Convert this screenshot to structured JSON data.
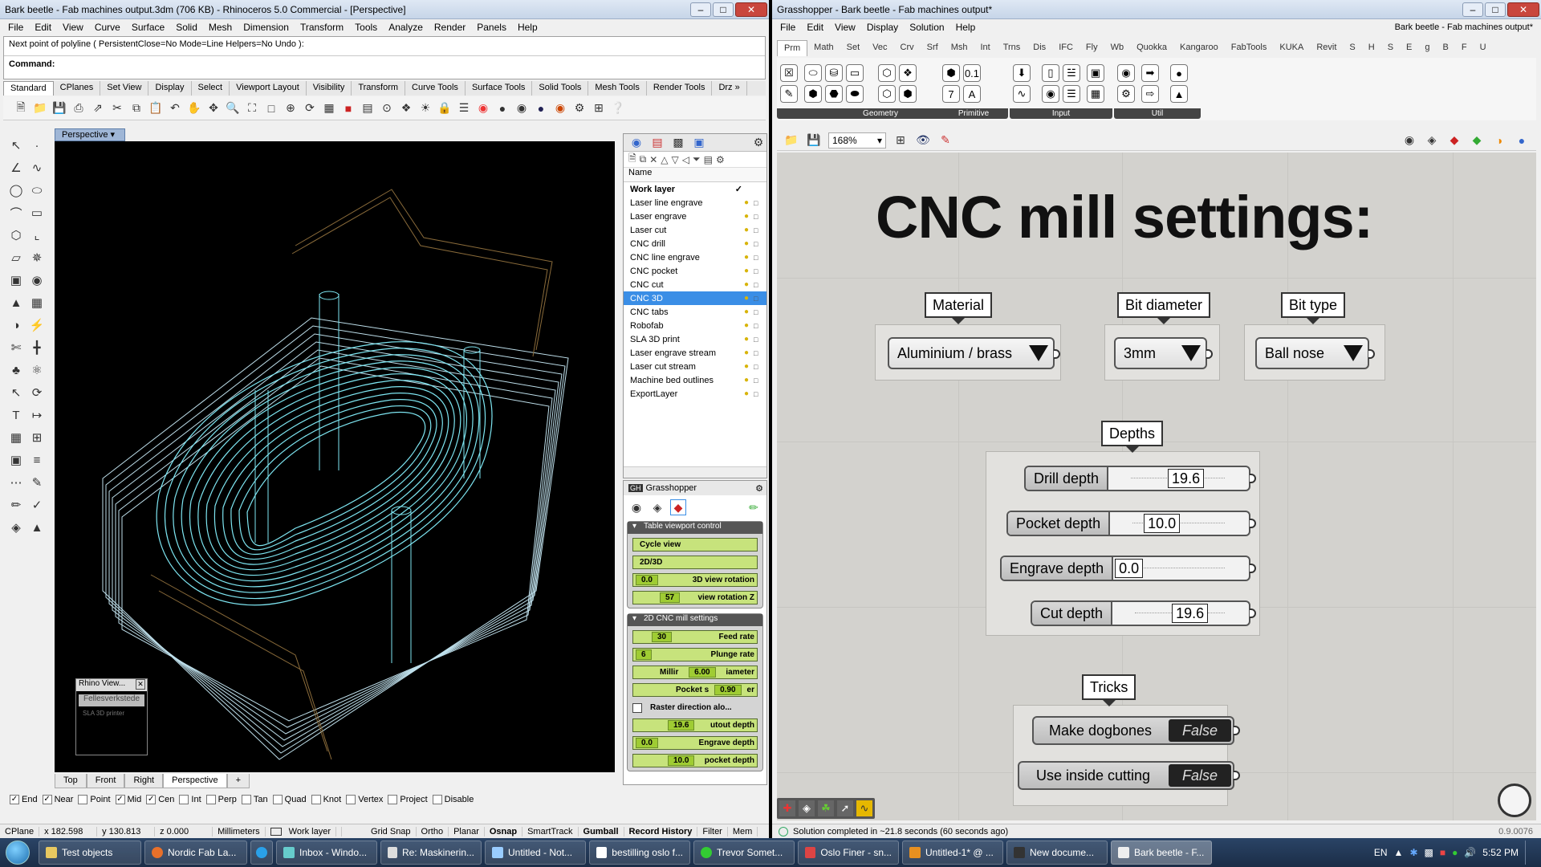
{
  "rhino": {
    "title": "Bark beetle - Fab machines output.3dm (706 KB) - Rhinoceros 5.0 Commercial - [Perspective]",
    "menu": [
      "File",
      "Edit",
      "View",
      "Curve",
      "Surface",
      "Solid",
      "Mesh",
      "Dimension",
      "Transform",
      "Tools",
      "Analyze",
      "Render",
      "Panels",
      "Help"
    ],
    "prompt": "Next point of polyline ( PersistentClose=No  Mode=Line  Helpers=No  Undo ):",
    "command_label": "Command:",
    "toolbar_tabs": [
      "Standard",
      "CPlanes",
      "Set View",
      "Display",
      "Select",
      "Viewport Layout",
      "Visibility",
      "Transform",
      "Curve Tools",
      "Surface Tools",
      "Solid Tools",
      "Mesh Tools",
      "Render Tools",
      "Drz »"
    ],
    "viewport_title": "Perspective",
    "viewport_tabs": [
      "Top",
      "Front",
      "Right",
      "Perspective",
      "+"
    ],
    "osnaps": [
      {
        "label": "End",
        "checked": "✓"
      },
      {
        "label": "Near",
        "checked": "✓"
      },
      {
        "label": "Point",
        "checked": ""
      },
      {
        "label": "Mid",
        "checked": "✓"
      },
      {
        "label": "Cen",
        "checked": "✓"
      },
      {
        "label": "Int",
        "checked": ""
      },
      {
        "label": "Perp",
        "checked": ""
      },
      {
        "label": "Tan",
        "checked": ""
      },
      {
        "label": "Quad",
        "checked": ""
      },
      {
        "label": "Knot",
        "checked": ""
      },
      {
        "label": "Vertex",
        "checked": ""
      },
      {
        "label": "Project",
        "checked": ""
      },
      {
        "label": "Disable",
        "checked": ""
      }
    ],
    "status": {
      "cplane": "CPlane",
      "x": "x 182.598",
      "y": "y 130.813",
      "z": "z 0.000",
      "units": "Millimeters",
      "layer": "Work layer",
      "grid_snap": "Grid Snap",
      "ortho": "Ortho",
      "planar": "Planar",
      "osnap": "Osnap",
      "smarttrack": "SmartTrack",
      "gumball": "Gumball",
      "record_history": "Record History",
      "filter": "Filter",
      "memory": "Mem"
    },
    "layers_header": "Name",
    "layers": [
      {
        "name": "Work layer",
        "current": "✓"
      },
      {
        "name": "Laser line engrave"
      },
      {
        "name": "Laser engrave"
      },
      {
        "name": "Laser cut"
      },
      {
        "name": "CNC drill"
      },
      {
        "name": "CNC line engrave"
      },
      {
        "name": "CNC pocket"
      },
      {
        "name": "CNC cut"
      },
      {
        "name": "CNC 3D",
        "selected": true
      },
      {
        "name": "CNC tabs"
      },
      {
        "name": "Robofab"
      },
      {
        "name": "SLA 3D print"
      },
      {
        "name": "Laser engrave stream"
      },
      {
        "name": "Laser cut stream"
      },
      {
        "name": "Machine bed outlines"
      },
      {
        "name": "ExportLayer"
      }
    ],
    "gh_panel": {
      "title": "Grasshopper",
      "group1": {
        "title": "Table viewport control",
        "cycle": "Cycle view",
        "view2d3d": "2D/3D",
        "rot_label": "3D view rotation",
        "rot_value": "0.0",
        "rotz_label": "view rotation Z",
        "rotz_value": "57"
      },
      "group2": {
        "title": "2D CNC mill settings",
        "feed_label": "Feed rate",
        "feed_value": "30",
        "plunge_label": "Plunge rate",
        "plunge_value": "6",
        "mill_label": "Millir",
        "mill_value": "6.00",
        "mill_suffix": "iameter",
        "pocket_label": "Pocket s",
        "pocket_value": "0.90",
        "pocket_suffix": "er",
        "raster_label": "Raster direction alo...",
        "cutout_label": "utout depth",
        "cutout_value": "19.6",
        "engrave_label": "Engrave depth",
        "engrave_value": "0.0",
        "pocketd_label": "pocket depth",
        "pocketd_value": "10.0"
      }
    },
    "mini_view": {
      "title": "Rhino View...",
      "item": "Fellesverkstede",
      "item2": "SLA 3D printer"
    }
  },
  "gh": {
    "title": "Grasshopper - Bark beetle - Fab machines output*",
    "doc_name": "Bark beetle - Fab machines output*",
    "menu": [
      "File",
      "Edit",
      "View",
      "Display",
      "Solution",
      "Help"
    ],
    "tabs": [
      "Prm",
      "Math",
      "Set",
      "Vec",
      "Crv",
      "Srf",
      "Msh",
      "Int",
      "Trns",
      "Dis",
      "IFC",
      "Fly",
      "Wb",
      "Quokka",
      "Kangaroo",
      "FabTools",
      "KUKA",
      "Revit",
      "S",
      "H",
      "S",
      "E",
      "g",
      "B",
      "F",
      "U"
    ],
    "ribbon_groups": [
      "Geometry",
      "Primitive",
      "Input",
      "Util"
    ],
    "zoom": "168%",
    "canvas_title": "CNC mill settings:",
    "material": {
      "label": "Material",
      "value": "Aluminium / brass"
    },
    "bit_diameter": {
      "label": "Bit diameter",
      "value": "3mm"
    },
    "bit_type": {
      "label": "Bit type",
      "value": "Ball nose"
    },
    "depths": {
      "label": "Depths",
      "drill": {
        "label": "Drill depth",
        "value": "19.6"
      },
      "pocket": {
        "label": "Pocket depth",
        "value": "10.0"
      },
      "engrave": {
        "label": "Engrave depth",
        "value": "0.0"
      },
      "cut": {
        "label": "Cut depth",
        "value": "19.6"
      }
    },
    "tricks": {
      "label": "Tricks",
      "dogbones": {
        "label": "Make dogbones",
        "value": "False"
      },
      "inside": {
        "label": "Use inside cutting",
        "value": "False"
      }
    },
    "status": "Solution completed in ~21.8 seconds (60 seconds ago)",
    "version": "0.9.0076"
  },
  "taskbar": {
    "items": [
      "Test objects",
      "Nordic Fab La...",
      "Inbox - Windo...",
      "Re: Maskinerin...",
      "Untitled - Not...",
      "bestilling oslo f...",
      "Trevor Somet...",
      "Oslo Finer - sn...",
      "Untitled-1* @ ...",
      "New docume...",
      "Bark beetle - F..."
    ],
    "lang": "EN",
    "time": "5:52 PM"
  }
}
